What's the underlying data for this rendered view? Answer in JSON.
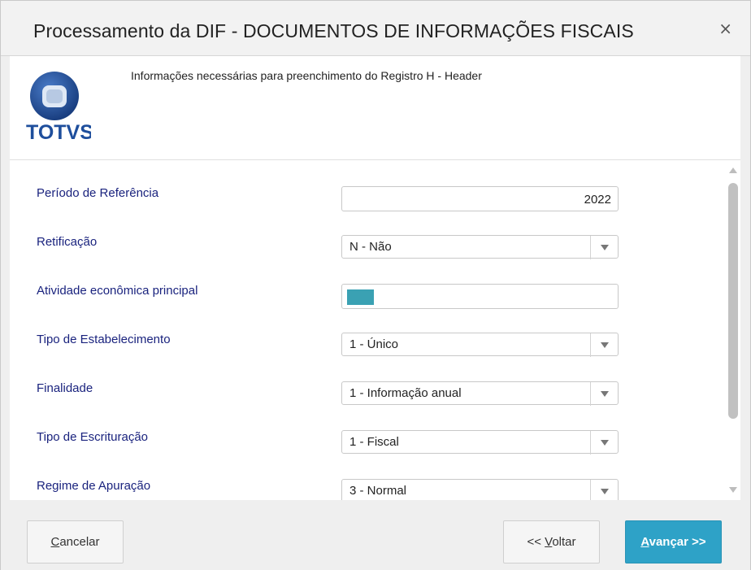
{
  "window": {
    "title": "Processamento da DIF - DOCUMENTOS DE INFORMAÇÕES FISCAIS",
    "close_glyph": "×"
  },
  "header": {
    "logo_text": "TOTVS",
    "description": "Informações necessárias para preenchimento do Registro H - Header"
  },
  "form": {
    "fields": [
      {
        "label": "Período de Referência",
        "value": "2022",
        "type": "text"
      },
      {
        "label": "Retificação",
        "value": "N - Não",
        "type": "select"
      },
      {
        "label": "Atividade econômica principal",
        "value": "",
        "type": "text"
      },
      {
        "label": "Tipo de Estabelecimento",
        "value": "1 - Único",
        "type": "select"
      },
      {
        "label": "Finalidade",
        "value": "1 - Informação anual",
        "type": "select"
      },
      {
        "label": "Tipo de Escrituração",
        "value": "1 - Fiscal",
        "type": "select"
      },
      {
        "label": "Regime de Apuração",
        "value": "3 - Normal",
        "type": "select"
      }
    ]
  },
  "footer": {
    "cancel_first": "C",
    "cancel_rest": "ancelar",
    "back_prefix": "<< ",
    "back_first": "V",
    "back_rest": "oltar",
    "next_first": "A",
    "next_rest": "vançar >>"
  },
  "colors": {
    "accent": "#2ea2c7",
    "label": "#1a237e",
    "logo_blue": "#1e4e9c",
    "chip": "#3aa1b3"
  }
}
